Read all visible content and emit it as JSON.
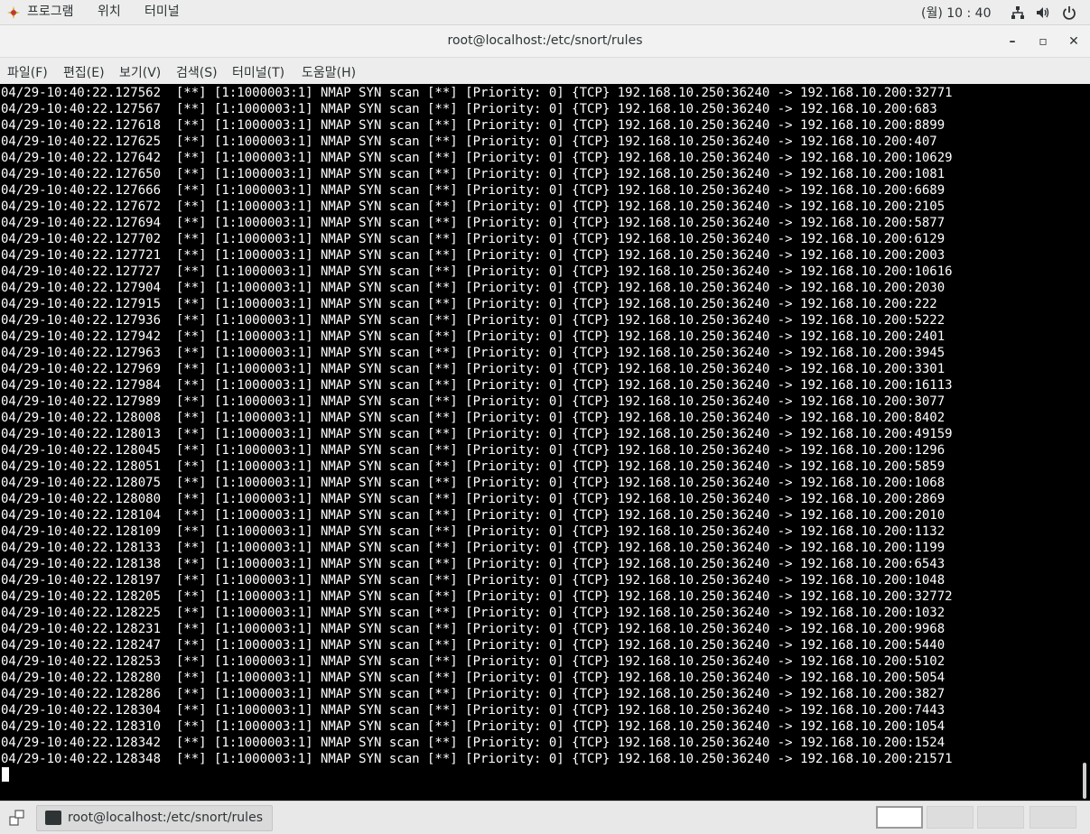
{
  "topbar": {
    "apps_label": "프로그램",
    "places_label": "위치",
    "terminal_label": "터미널",
    "clock": "(월) 10 : 40"
  },
  "window": {
    "title": "root@localhost:/etc/snort/rules",
    "minimize": "–",
    "maximize": "▫",
    "close": "✕"
  },
  "menu": {
    "items": [
      "파일(F)",
      "편집(E)",
      "보기(V)",
      "검색(S)",
      "터미널(T)",
      "도움말(H)"
    ]
  },
  "terminal": {
    "lines": [
      "04/29-10:40:22.127562  [**] [1:1000003:1] NMAP SYN scan [**] [Priority: 0] {TCP} 192.168.10.250:36240 -> 192.168.10.200:32771",
      "04/29-10:40:22.127567  [**] [1:1000003:1] NMAP SYN scan [**] [Priority: 0] {TCP} 192.168.10.250:36240 -> 192.168.10.200:683",
      "04/29-10:40:22.127618  [**] [1:1000003:1] NMAP SYN scan [**] [Priority: 0] {TCP} 192.168.10.250:36240 -> 192.168.10.200:8899",
      "04/29-10:40:22.127625  [**] [1:1000003:1] NMAP SYN scan [**] [Priority: 0] {TCP} 192.168.10.250:36240 -> 192.168.10.200:407",
      "04/29-10:40:22.127642  [**] [1:1000003:1] NMAP SYN scan [**] [Priority: 0] {TCP} 192.168.10.250:36240 -> 192.168.10.200:10629",
      "04/29-10:40:22.127650  [**] [1:1000003:1] NMAP SYN scan [**] [Priority: 0] {TCP} 192.168.10.250:36240 -> 192.168.10.200:1081",
      "04/29-10:40:22.127666  [**] [1:1000003:1] NMAP SYN scan [**] [Priority: 0] {TCP} 192.168.10.250:36240 -> 192.168.10.200:6689",
      "04/29-10:40:22.127672  [**] [1:1000003:1] NMAP SYN scan [**] [Priority: 0] {TCP} 192.168.10.250:36240 -> 192.168.10.200:2105",
      "04/29-10:40:22.127694  [**] [1:1000003:1] NMAP SYN scan [**] [Priority: 0] {TCP} 192.168.10.250:36240 -> 192.168.10.200:5877",
      "04/29-10:40:22.127702  [**] [1:1000003:1] NMAP SYN scan [**] [Priority: 0] {TCP} 192.168.10.250:36240 -> 192.168.10.200:6129",
      "04/29-10:40:22.127721  [**] [1:1000003:1] NMAP SYN scan [**] [Priority: 0] {TCP} 192.168.10.250:36240 -> 192.168.10.200:2003",
      "04/29-10:40:22.127727  [**] [1:1000003:1] NMAP SYN scan [**] [Priority: 0] {TCP} 192.168.10.250:36240 -> 192.168.10.200:10616",
      "04/29-10:40:22.127904  [**] [1:1000003:1] NMAP SYN scan [**] [Priority: 0] {TCP} 192.168.10.250:36240 -> 192.168.10.200:2030",
      "04/29-10:40:22.127915  [**] [1:1000003:1] NMAP SYN scan [**] [Priority: 0] {TCP} 192.168.10.250:36240 -> 192.168.10.200:222",
      "04/29-10:40:22.127936  [**] [1:1000003:1] NMAP SYN scan [**] [Priority: 0] {TCP} 192.168.10.250:36240 -> 192.168.10.200:5222",
      "04/29-10:40:22.127942  [**] [1:1000003:1] NMAP SYN scan [**] [Priority: 0] {TCP} 192.168.10.250:36240 -> 192.168.10.200:2401",
      "04/29-10:40:22.127963  [**] [1:1000003:1] NMAP SYN scan [**] [Priority: 0] {TCP} 192.168.10.250:36240 -> 192.168.10.200:3945",
      "04/29-10:40:22.127969  [**] [1:1000003:1] NMAP SYN scan [**] [Priority: 0] {TCP} 192.168.10.250:36240 -> 192.168.10.200:3301",
      "04/29-10:40:22.127984  [**] [1:1000003:1] NMAP SYN scan [**] [Priority: 0] {TCP} 192.168.10.250:36240 -> 192.168.10.200:16113",
      "04/29-10:40:22.127989  [**] [1:1000003:1] NMAP SYN scan [**] [Priority: 0] {TCP} 192.168.10.250:36240 -> 192.168.10.200:3077",
      "04/29-10:40:22.128008  [**] [1:1000003:1] NMAP SYN scan [**] [Priority: 0] {TCP} 192.168.10.250:36240 -> 192.168.10.200:8402",
      "04/29-10:40:22.128013  [**] [1:1000003:1] NMAP SYN scan [**] [Priority: 0] {TCP} 192.168.10.250:36240 -> 192.168.10.200:49159",
      "04/29-10:40:22.128045  [**] [1:1000003:1] NMAP SYN scan [**] [Priority: 0] {TCP} 192.168.10.250:36240 -> 192.168.10.200:1296",
      "04/29-10:40:22.128051  [**] [1:1000003:1] NMAP SYN scan [**] [Priority: 0] {TCP} 192.168.10.250:36240 -> 192.168.10.200:5859",
      "04/29-10:40:22.128075  [**] [1:1000003:1] NMAP SYN scan [**] [Priority: 0] {TCP} 192.168.10.250:36240 -> 192.168.10.200:1068",
      "04/29-10:40:22.128080  [**] [1:1000003:1] NMAP SYN scan [**] [Priority: 0] {TCP} 192.168.10.250:36240 -> 192.168.10.200:2869",
      "04/29-10:40:22.128104  [**] [1:1000003:1] NMAP SYN scan [**] [Priority: 0] {TCP} 192.168.10.250:36240 -> 192.168.10.200:2010",
      "04/29-10:40:22.128109  [**] [1:1000003:1] NMAP SYN scan [**] [Priority: 0] {TCP} 192.168.10.250:36240 -> 192.168.10.200:1132",
      "04/29-10:40:22.128133  [**] [1:1000003:1] NMAP SYN scan [**] [Priority: 0] {TCP} 192.168.10.250:36240 -> 192.168.10.200:1199",
      "04/29-10:40:22.128138  [**] [1:1000003:1] NMAP SYN scan [**] [Priority: 0] {TCP} 192.168.10.250:36240 -> 192.168.10.200:6543",
      "04/29-10:40:22.128197  [**] [1:1000003:1] NMAP SYN scan [**] [Priority: 0] {TCP} 192.168.10.250:36240 -> 192.168.10.200:1048",
      "04/29-10:40:22.128205  [**] [1:1000003:1] NMAP SYN scan [**] [Priority: 0] {TCP} 192.168.10.250:36240 -> 192.168.10.200:32772",
      "04/29-10:40:22.128225  [**] [1:1000003:1] NMAP SYN scan [**] [Priority: 0] {TCP} 192.168.10.250:36240 -> 192.168.10.200:1032",
      "04/29-10:40:22.128231  [**] [1:1000003:1] NMAP SYN scan [**] [Priority: 0] {TCP} 192.168.10.250:36240 -> 192.168.10.200:9968",
      "04/29-10:40:22.128247  [**] [1:1000003:1] NMAP SYN scan [**] [Priority: 0] {TCP} 192.168.10.250:36240 -> 192.168.10.200:5440",
      "04/29-10:40:22.128253  [**] [1:1000003:1] NMAP SYN scan [**] [Priority: 0] {TCP} 192.168.10.250:36240 -> 192.168.10.200:5102",
      "04/29-10:40:22.128280  [**] [1:1000003:1] NMAP SYN scan [**] [Priority: 0] {TCP} 192.168.10.250:36240 -> 192.168.10.200:5054",
      "04/29-10:40:22.128286  [**] [1:1000003:1] NMAP SYN scan [**] [Priority: 0] {TCP} 192.168.10.250:36240 -> 192.168.10.200:3827",
      "04/29-10:40:22.128304  [**] [1:1000003:1] NMAP SYN scan [**] [Priority: 0] {TCP} 192.168.10.250:36240 -> 192.168.10.200:7443",
      "04/29-10:40:22.128310  [**] [1:1000003:1] NMAP SYN scan [**] [Priority: 0] {TCP} 192.168.10.250:36240 -> 192.168.10.200:1054",
      "04/29-10:40:22.128342  [**] [1:1000003:1] NMAP SYN scan [**] [Priority: 0] {TCP} 192.168.10.250:36240 -> 192.168.10.200:1524",
      "04/29-10:40:22.128348  [**] [1:1000003:1] NMAP SYN scan [**] [Priority: 0] {TCP} 192.168.10.250:36240 -> 192.168.10.200:21571"
    ]
  },
  "taskbar": {
    "task_label": "root@localhost:/etc/snort/rules"
  }
}
